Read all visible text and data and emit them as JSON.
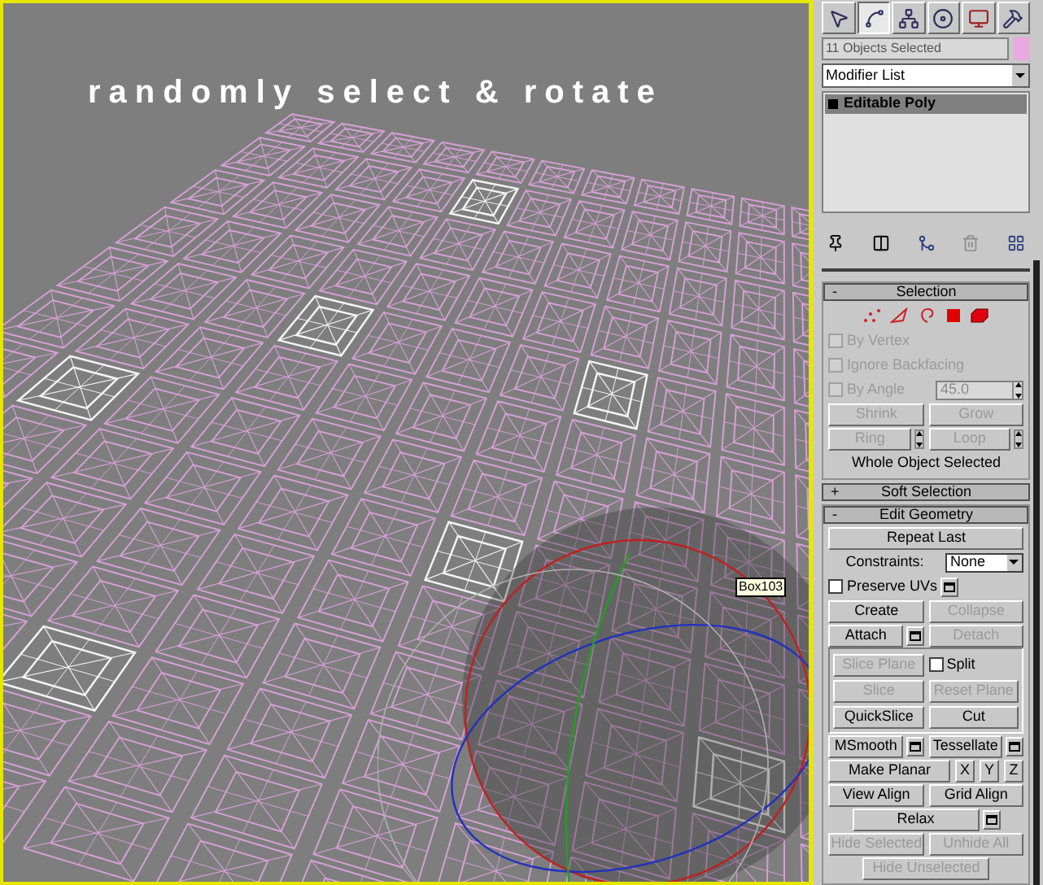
{
  "viewport": {
    "caption": "randomly select & rotate",
    "tooltip": "Box103"
  },
  "command_panel": {
    "tabs": [
      {
        "selected": false
      },
      {
        "selected": true
      },
      {
        "selected": false
      },
      {
        "selected": false
      },
      {
        "selected": false
      },
      {
        "selected": false
      }
    ],
    "selection_name": "11 Objects Selected",
    "modifier_list": "Modifier List",
    "stack": [
      {
        "label": "Editable Poly",
        "selected": true
      }
    ],
    "rollouts": [
      {
        "title": "Selection",
        "sign": "-",
        "expanded": true,
        "subobject_levels": [
          {
            "selected": false
          },
          {
            "selected": false
          },
          {
            "selected": false
          },
          {
            "selected": false
          },
          {
            "selected": false
          }
        ],
        "rows": [
          {
            "items": [
              {
                "kind": "checkbox",
                "label": "By Vertex",
                "checked": false,
                "disabled": true
              }
            ]
          },
          {
            "items": [
              {
                "kind": "checkbox",
                "label": "Ignore Backfacing",
                "checked": false,
                "disabled": true
              }
            ]
          },
          {
            "items": [
              {
                "kind": "checkbox",
                "label": "By Angle",
                "checked": false,
                "disabled": true
              },
              {
                "kind": "spinner",
                "value": "45.0",
                "disabled": true
              }
            ]
          },
          {
            "items": [
              {
                "kind": "button",
                "label": "Shrink",
                "disabled": true
              },
              {
                "kind": "button",
                "label": "Grow",
                "disabled": true
              }
            ]
          },
          {
            "items": [
              {
                "kind": "button",
                "label": "Ring",
                "disabled": true,
                "arrows": true
              },
              {
                "kind": "button",
                "label": "Loop",
                "disabled": true,
                "arrows": true
              }
            ]
          },
          {
            "items": [
              {
                "kind": "label",
                "label": "Whole Object Selected"
              }
            ]
          }
        ]
      },
      {
        "title": "Soft Selection",
        "sign": "+",
        "expanded": false
      },
      {
        "title": "Edit Geometry",
        "sign": "-",
        "expanded": true,
        "rows": [
          {
            "items": [
              {
                "kind": "button",
                "label": "Repeat Last",
                "disabled": false
              }
            ]
          },
          {
            "items": [
              {
                "kind": "label",
                "label": "Constraints:"
              },
              {
                "kind": "dropdown",
                "value": "None"
              }
            ]
          },
          {
            "items": [
              {
                "kind": "checkbox",
                "label": "Preserve UVs",
                "checked": false,
                "disabled": false,
                "settings": true
              }
            ]
          },
          {
            "items": [
              {
                "kind": "button",
                "label": "Create",
                "disabled": false
              },
              {
                "kind": "button",
                "label": "Collapse",
                "disabled": true
              }
            ]
          },
          {
            "items": [
              {
                "kind": "button",
                "label": "Attach",
                "disabled": false,
                "settings": true
              },
              {
                "kind": "button",
                "label": "Detach",
                "disabled": true
              }
            ]
          },
          {
            "kind": "group",
            "rows": [
              {
                "items": [
                  {
                    "kind": "button",
                    "label": "Slice Plane",
                    "disabled": true
                  },
                  {
                    "kind": "checkbox",
                    "label": "Split",
                    "checked": false,
                    "disabled": false
                  }
                ]
              },
              {
                "items": [
                  {
                    "kind": "button",
                    "label": "Slice",
                    "disabled": true
                  },
                  {
                    "kind": "button",
                    "label": "Reset Plane",
                    "disabled": true
                  }
                ]
              },
              {
                "items": [
                  {
                    "kind": "button",
                    "label": "QuickSlice",
                    "disabled": false
                  },
                  {
                    "kind": "button",
                    "label": "Cut",
                    "disabled": false
                  }
                ]
              }
            ]
          },
          {
            "items": [
              {
                "kind": "button",
                "label": "MSmooth",
                "disabled": false,
                "settings": true
              },
              {
                "kind": "button",
                "label": "Tessellate",
                "disabled": false,
                "settings": true
              }
            ]
          },
          {
            "items": [
              {
                "kind": "button",
                "label": "Make Planar",
                "disabled": false
              },
              {
                "kind": "axis",
                "label": "X",
                "disabled": false
              },
              {
                "kind": "axis",
                "label": "Y",
                "disabled": false
              },
              {
                "kind": "axis",
                "label": "Z",
                "disabled": false
              }
            ]
          },
          {
            "items": [
              {
                "kind": "button",
                "label": "View Align",
                "disabled": false
              },
              {
                "kind": "button",
                "label": "Grid Align",
                "disabled": false
              }
            ]
          },
          {
            "items": [
              {
                "kind": "button",
                "label": "Relax",
                "disabled": false,
                "settings": true,
                "narrow": true
              }
            ]
          },
          {
            "items": [
              {
                "kind": "button",
                "label": "Hide Selected",
                "disabled": true
              },
              {
                "kind": "button",
                "label": "Unhide All",
                "disabled": true
              }
            ]
          },
          {
            "items": [
              {
                "kind": "button",
                "label": "Hide Unselected",
                "disabled": true,
                "narrow": true
              }
            ]
          }
        ]
      }
    ]
  }
}
